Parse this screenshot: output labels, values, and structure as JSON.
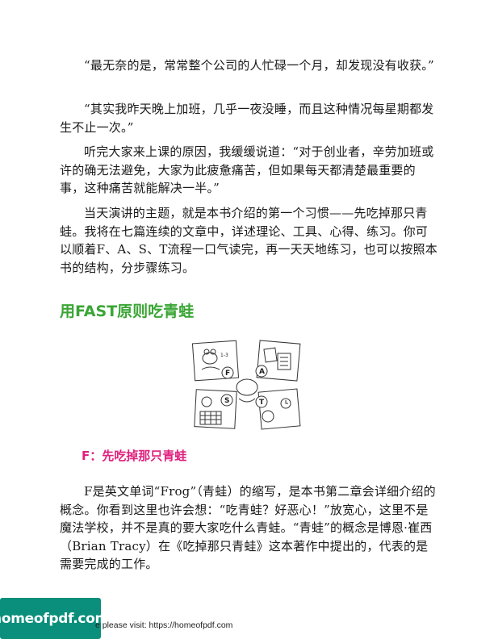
{
  "colors": {
    "heading_green": "#3aa535",
    "subheading_magenta": "#e0207f",
    "watermark_bg": "#0a8f7c",
    "watermark_text": "#ffffff"
  },
  "paragraphs": [
    "“最无奈的是，常常整个公司的人忙碌一个月，却发现没有收获。”",
    "“其实我昨天晚上加班，几乎一夜没睡，而且这种情况每星期都发生不止一次。”",
    "听完大家来上课的原因，我缓缓说道：“对于创业者，辛劳加班或许的确无法避免，大家为此疲惫痛苦，但如果每天都清楚最重要的事，这种痛苦就能解决一半。”",
    "当天演讲的主题，就是本书介绍的第一个习惯——先吃掉那只青蛙。我将在七篇连续的文章中，详述理论、工具、心得、练习。你可以顺着F、A、S、T流程一口气读完，再一天天地练习，也可以按照本书的结构，分步骤练习。",
    "F是英文单词“Frog”（青蛙）的缩写，是本书第二章会详细介绍的概念。你看到这里也许会想：“吃青蛙？好恶心！”放宽心，这里不是魔法学校，并不是真的要大家吃什么青蛙。“青蛙”的概念是博恩·崔西（Brian Tracy）在《吃掉那只青蛙》这本著作中提出的，代表的是需要完成的工作。"
  ],
  "section_heading": "用FAST原则吃青蛙",
  "sub_heading": "F：先吃掉那只青蛙",
  "figure": {
    "letters": [
      "F",
      "A",
      "S",
      "T"
    ],
    "small_label": "1-3"
  },
  "watermark": "homeofpdf.com",
  "footer": "e please visit: https://homeofpdf.com"
}
